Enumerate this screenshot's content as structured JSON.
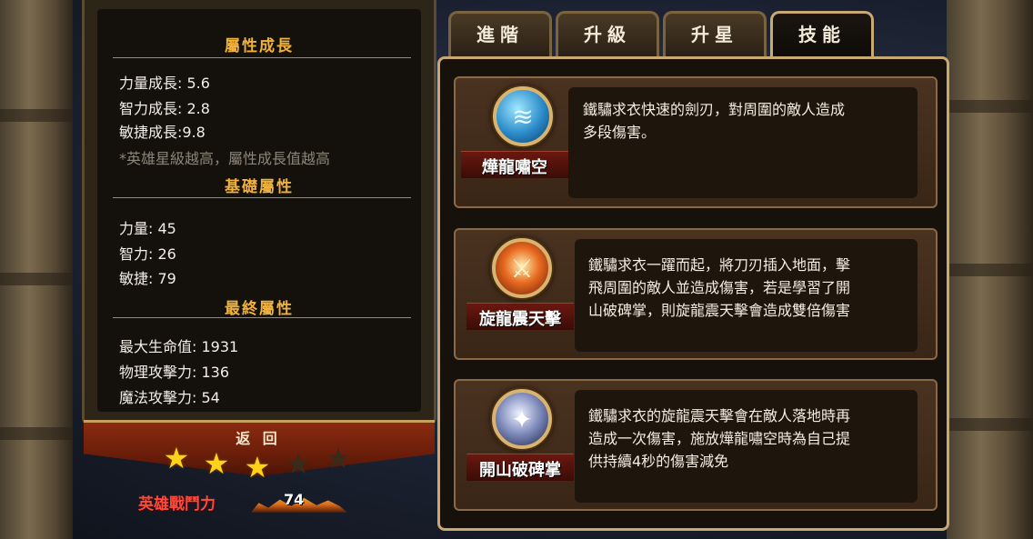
{
  "stats": {
    "growth_title": "屬性成長",
    "growth": [
      "力量成長: 5.6",
      "智力成長: 2.8",
      "敏捷成長:9.8"
    ],
    "growth_note": "*英雄星級越高，屬性成長值越高",
    "base_title": "基礎屬性",
    "base": [
      "力量: 45",
      "智力: 26",
      "敏捷: 79"
    ],
    "final_title": "最終屬性",
    "final": [
      "最大生命值: 1931",
      "物理攻擊力: 136",
      "魔法攻擊力: 54"
    ]
  },
  "back_label": "返 回",
  "stars": {
    "filled": 3,
    "total": 5
  },
  "power": {
    "label": "英雄戰鬥力",
    "value": "74"
  },
  "tabs": [
    {
      "label": "進階",
      "active": false
    },
    {
      "label": "升級",
      "active": false
    },
    {
      "label": "升星",
      "active": false
    },
    {
      "label": "技能",
      "active": true
    }
  ],
  "skills": [
    {
      "name": "燁龍嘯空",
      "icon": "whirlwind-icon",
      "desc": [
        "鐵驌求衣快速的劍刃，對周圍的敵人造成",
        "多段傷害。"
      ]
    },
    {
      "name": "旋龍震天擊",
      "icon": "sword-burst-icon",
      "desc": [
        "鐵驌求衣一躍而起，將刀刃插入地面，擊",
        "飛周圍的敵人並造成傷害，若是學習了開",
        "山破碑掌，則旋龍震天擊會造成雙倍傷害"
      ]
    },
    {
      "name": "開山破碑掌",
      "icon": "blade-guard-icon",
      "desc": [
        "鐵驌求衣的旋龍震天擊會在敵人落地時再",
        "造成一次傷害，施放燁龍嘯空時為自己提",
        "供持續4秒的傷害減免"
      ]
    }
  ],
  "colors": {
    "section_title": "#f0b23a",
    "power_label": "#ff4a3a",
    "star_on": "#ffd21a"
  }
}
